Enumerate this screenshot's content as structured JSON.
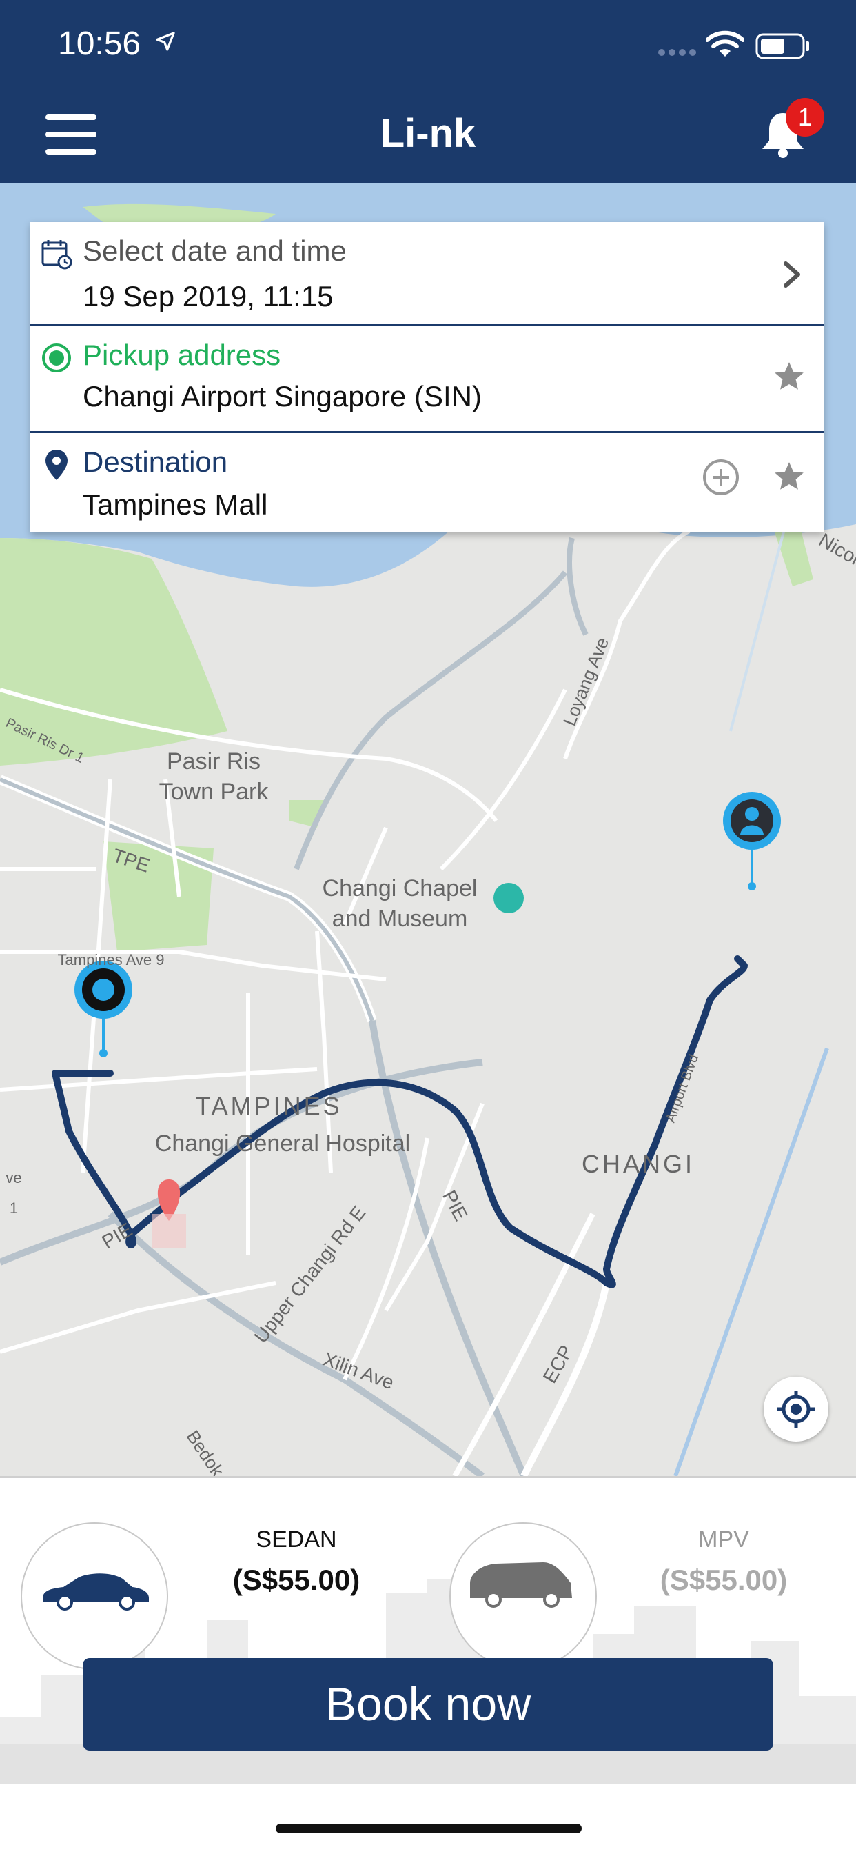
{
  "status_bar": {
    "time": "10:56"
  },
  "header": {
    "title": "Li-nk",
    "notification_count": "1"
  },
  "booking": {
    "date": {
      "label": "Select date and time",
      "value": "19 Sep 2019, 11:15"
    },
    "pickup": {
      "label": "Pickup address",
      "value": "Changi Airport Singapore (SIN)"
    },
    "destination": {
      "label": "Destination",
      "value": "Tampines Mall"
    }
  },
  "map": {
    "labels": {
      "pasir_ris_park": "Pasir Ris\nTown Park",
      "changi_chapel": "Changi Chapel\nand Museum",
      "tampines": "TAMPINES",
      "changi_general": "Changi General Hospital",
      "changi": "CHANGI",
      "loyang_ave": "Loyang Ave",
      "tpe": "TPE",
      "pie": "PIE",
      "pie2": "PIE",
      "upper_changi": "Upper Changi Rd E",
      "xilin_ave": "Xilin Ave",
      "ecp": "ECP",
      "tampines_ave9": "Tampines Ave 9",
      "pasir_ris_dr1": "Pasir Ris Dr 1",
      "bedok": "Bedok R",
      "airport_blvd": "Airport Blvd",
      "nicoll": "Nicoll",
      "ave1": "ve 1"
    },
    "colors": {
      "route": "#1b3a6b",
      "pin": "#29a8e8",
      "water": "#a9c9e8",
      "park": "#c6e4b2"
    }
  },
  "vehicles": [
    {
      "name": "SEDAN",
      "price": "(S$55.00)",
      "selected": true
    },
    {
      "name": "MPV",
      "price": "(S$55.00)",
      "selected": false
    }
  ],
  "actions": {
    "book_label": "Book now"
  },
  "colors": {
    "primary": "#1b3a6b",
    "badge": "#e21c1c",
    "pickup_green": "#20b05a"
  }
}
